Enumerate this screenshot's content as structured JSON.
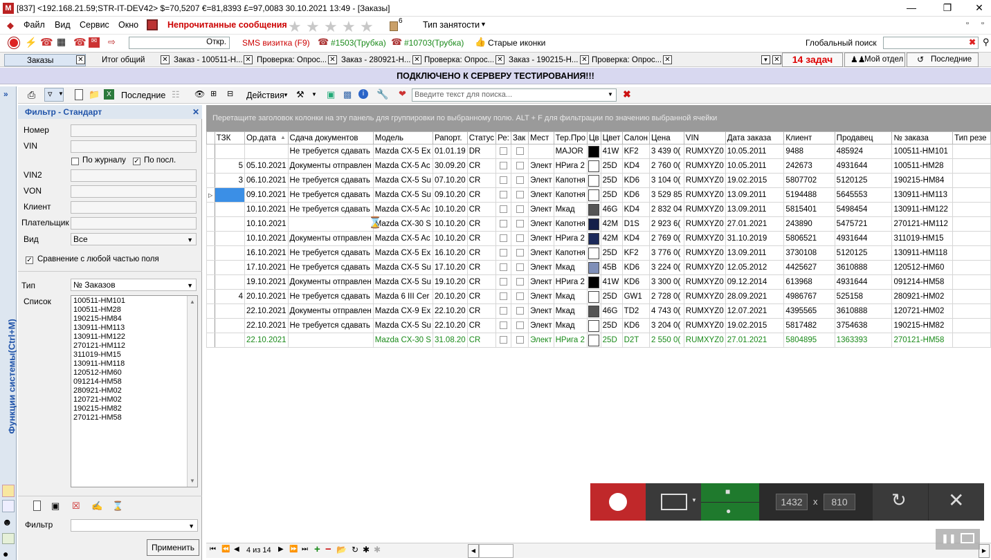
{
  "window": {
    "title": "[837] <192.168.21.59;STR-IT-DEV42> $=70,5207 €=81,8393 £=97,0083 30.10.2021 13:49 - [Заказы]",
    "icon_text": "M"
  },
  "menu": {
    "file": "Файл",
    "view": "Вид",
    "service": "Сервис",
    "window": "Окно",
    "unread": "Непрочитанные сообщения",
    "badge_count": "6",
    "employment_type": "Тип занятости"
  },
  "toolbar2": {
    "open_label": "Откр.",
    "sms": "SMS визитка (F9)",
    "phone1": "#1503(Трубка)",
    "phone2": "#10703(Трубка)",
    "old_icons": "Старые иконки",
    "global_search": "Глобальный поиск"
  },
  "tabs": [
    {
      "label": "Заказы"
    },
    {
      "label": "Итог общий"
    },
    {
      "label": "Заказ - 100511-Н..."
    },
    {
      "label": "Проверка: Опрос..."
    },
    {
      "label": "Заказ - 280921-Н..."
    },
    {
      "label": "Проверка: Опрос..."
    },
    {
      "label": "Заказ - 190215-Н..."
    },
    {
      "label": "Проверка: Опрос..."
    }
  ],
  "tasks": "14 задач",
  "my_dept": "Мой отдел",
  "recent_tab": "Последние",
  "banner": "ПОДКЛЮЧЕНО К СЕРВЕРУ ТЕСТИРОВАНИЯ!!!",
  "side_label": "Функции системы(Ctrl+M)",
  "panel_toolbar": {
    "recent": "Последние",
    "actions": "Действия",
    "search_placeholder": "Введите текст для поиска..."
  },
  "filter": {
    "title": "Фильтр - Стандарт",
    "number": "Номер",
    "vin": "VIN",
    "by_journal": "По журналу",
    "by_last": "По посл.",
    "vin2": "VIN2",
    "von": "VON",
    "client": "Клиент",
    "payer": "Плательщик",
    "view": "Вид",
    "view_value": "Все",
    "compare": "Сравнение с любой частью поля",
    "type": "Тип",
    "type_value": "№ Заказов",
    "list": "Список",
    "list_items": [
      "100511-HM101",
      "100511-HM28",
      "190215-HM84",
      "130911-HM113",
      "130911-HM122",
      "270121-HM112",
      "311019-HM15",
      "130911-HM118",
      "120512-HM60",
      "091214-HM58",
      "280921-HM02",
      "120721-HM02",
      "190215-HM82",
      "270121-HM58"
    ],
    "filter_label": "Фильтр",
    "apply": "Применить"
  },
  "group_hint": "Перетащите заголовок колонки на эту панель для группировки по выбранному полю. ALT + F для фильтрации по значению выбранной ячейки",
  "columns": [
    "ТЗК",
    "Ор.дата",
    "Сдача документов",
    "Модель",
    "Рапорт.",
    "Статус",
    "Ре:",
    "Зак",
    "Мест",
    "Тер.Про",
    "Цв",
    "Цвет",
    "Салон",
    "Цена",
    "VIN",
    "Дата заказа",
    "Клиент",
    "Продавец",
    "№ заказа",
    "Тип резе"
  ],
  "rows": [
    {
      "tzk": "",
      "date": "",
      "docs": "Не требуется сдавать",
      "model": "Mazda CX-5 Ex",
      "rap": "01.01.19",
      "status": "DR",
      "place": "",
      "ter": "MAJOR",
      "sw": "#000000",
      "color": "41W",
      "salon": "KF2",
      "price": "3 439 0(",
      "vin": "RUMXYZ0",
      "odate": "10.05.2011",
      "client": "9488",
      "seller": "485924",
      "order": "100511-HM101",
      "green": false
    },
    {
      "tzk": "5",
      "date": "05.10.2021",
      "docs": "Документы отправлен",
      "model": "Mazda CX-5 Ac",
      "rap": "30.09.20",
      "status": "CR",
      "place": "Элект",
      "ter": "НРига 2",
      "sw": "#ffffff",
      "color": "25D",
      "salon": "KD4",
      "price": "2 760 0(",
      "vin": "RUMXYZ0",
      "odate": "10.05.2011",
      "client": "242673",
      "seller": "4931644",
      "order": "100511-HM28",
      "green": false
    },
    {
      "tzk": "3",
      "date": "06.10.2021",
      "docs": "Не требуется сдавать",
      "model": "Mazda CX-5 Su",
      "rap": "07.10.20",
      "status": "CR",
      "place": "Элект",
      "ter": "Капотня",
      "sw": "#ffffff",
      "color": "25D",
      "salon": "KD6",
      "price": "3 104 0(",
      "vin": "RUMXYZ0",
      "odate": "19.02.2015",
      "client": "5807702",
      "seller": "5120125",
      "order": "190215-HM84",
      "green": false
    },
    {
      "tzk": "",
      "date": "09.10.2021",
      "docs": "Не требуется сдавать",
      "model": "Mazda CX-5 Su",
      "rap": "09.10.20",
      "status": "CR",
      "place": "Элект",
      "ter": "Капотня",
      "sw": "#ffffff",
      "color": "25D",
      "salon": "KD6",
      "price": "3 529 85",
      "vin": "RUMXYZ0",
      "odate": "13.09.2011",
      "client": "5194488",
      "seller": "5645553",
      "order": "130911-HM113",
      "green": false,
      "current": true
    },
    {
      "tzk": "",
      "date": "10.10.2021",
      "docs": "Не требуется сдавать",
      "model": "Mazda CX-5 Ac",
      "rap": "10.10.20",
      "status": "CR",
      "place": "Элект",
      "ter": "Мкад",
      "sw": "#555555",
      "color": "46G",
      "salon": "KD4",
      "price": "2 832 04",
      "vin": "RUMXYZ0",
      "odate": "13.09.2011",
      "client": "5815401",
      "seller": "5498454",
      "order": "130911-HM122",
      "green": false
    },
    {
      "tzk": "",
      "date": "10.10.2021",
      "docs": "",
      "model": "Mazda CX-30 S",
      "rap": "10.10.20",
      "status": "CR",
      "place": "Элект",
      "ter": "Капотня",
      "sw": "#15204a",
      "color": "42M",
      "salon": "D1S",
      "price": "2 923 6(",
      "vin": "RUMXYZ0",
      "odate": "27.01.2021",
      "client": "243890",
      "seller": "5475721",
      "order": "270121-HM112",
      "green": false
    },
    {
      "tzk": "",
      "date": "10.10.2021",
      "docs": "Документы отправлен",
      "model": "Mazda CX-5 Ac",
      "rap": "10.10.20",
      "status": "CR",
      "place": "Элект",
      "ter": "НРига 2",
      "sw": "#1c2a5a",
      "color": "42M",
      "salon": "KD4",
      "price": "2 769 0(",
      "vin": "RUMXYZ0",
      "odate": "31.10.2019",
      "client": "5806521",
      "seller": "4931644",
      "order": "311019-HM15",
      "green": false
    },
    {
      "tzk": "",
      "date": "16.10.2021",
      "docs": "Не требуется сдавать",
      "model": "Mazda CX-5 Ex",
      "rap": "16.10.20",
      "status": "CR",
      "place": "Элект",
      "ter": "Капотня",
      "sw": "#ffffff",
      "color": "25D",
      "salon": "KF2",
      "price": "3 776 0(",
      "vin": "RUMXYZ0",
      "odate": "13.09.2011",
      "client": "3730108",
      "seller": "5120125",
      "order": "130911-HM118",
      "green": false
    },
    {
      "tzk": "",
      "date": "17.10.2021",
      "docs": "Не требуется сдавать",
      "model": "Mazda CX-5 Su",
      "rap": "17.10.20",
      "status": "CR",
      "place": "Элект",
      "ter": "Мкад",
      "sw": "#7f8fb8",
      "color": "45B",
      "salon": "KD6",
      "price": "3 224 0(",
      "vin": "RUMXYZ0",
      "odate": "12.05.2012",
      "client": "4425627",
      "seller": "3610888",
      "order": "120512-HM60",
      "green": false
    },
    {
      "tzk": "",
      "date": "19.10.2021",
      "docs": "Документы отправлен",
      "model": "Mazda CX-5 Su",
      "rap": "19.10.20",
      "status": "CR",
      "place": "Элект",
      "ter": "НРига 2",
      "sw": "#000000",
      "color": "41W",
      "salon": "KD6",
      "price": "3 300 0(",
      "vin": "RUMXYZ0",
      "odate": "09.12.2014",
      "client": "613968",
      "seller": "4931644",
      "order": "091214-HM58",
      "green": false
    },
    {
      "tzk": "4",
      "date": "20.10.2021",
      "docs": "Не требуется сдавать",
      "model": "Mazda 6 III Cer",
      "rap": "20.10.20",
      "status": "CR",
      "place": "Элект",
      "ter": "Мкад",
      "sw": "#ffffff",
      "color": "25D",
      "salon": "GW1",
      "price": "2 728 0(",
      "vin": "RUMXYZ0",
      "odate": "28.09.2021",
      "client": "4986767",
      "seller": "525158",
      "order": "280921-HM02",
      "green": false
    },
    {
      "tzk": "",
      "date": "22.10.2021",
      "docs": "Документы отправлен",
      "model": "Mazda CX-9 Ex",
      "rap": "22.10.20",
      "status": "CR",
      "place": "Элект",
      "ter": "Мкад",
      "sw": "#555555",
      "color": "46G",
      "salon": "TD2",
      "price": "4 743 0(",
      "vin": "RUMXYZ0",
      "odate": "12.07.2021",
      "client": "4395565",
      "seller": "3610888",
      "order": "120721-HM02",
      "green": false
    },
    {
      "tzk": "",
      "date": "22.10.2021",
      "docs": "Не требуется сдавать",
      "model": "Mazda CX-5 Su",
      "rap": "22.10.20",
      "status": "CR",
      "place": "Элект",
      "ter": "Мкад",
      "sw": "#ffffff",
      "color": "25D",
      "salon": "KD6",
      "price": "3 204 0(",
      "vin": "RUMXYZ0",
      "odate": "19.02.2015",
      "client": "5817482",
      "seller": "3754638",
      "order": "190215-HM82",
      "green": false
    },
    {
      "tzk": "",
      "date": "22.10.2021",
      "docs": "",
      "model": "Mazda CX-30 S",
      "rap": "31.08.20",
      "status": "CR",
      "place": "Элект",
      "ter": "НРига 2",
      "sw": "#ffffff",
      "color": "25D",
      "salon": "D2T",
      "price": "2 550 0(",
      "vin": "RUMXYZ0",
      "odate": "27.01.2021",
      "client": "5804895",
      "seller": "1363393",
      "order": "270121-HM58",
      "green": true
    }
  ],
  "nav": {
    "page": "4 из 14"
  },
  "recorder": {
    "width": "1432",
    "x": "x",
    "height": "810"
  }
}
